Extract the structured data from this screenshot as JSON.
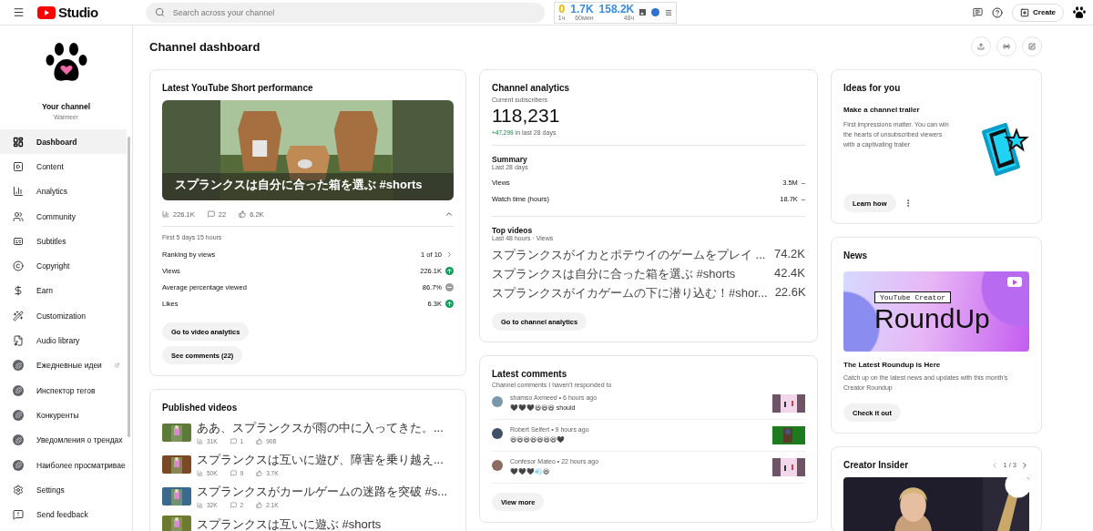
{
  "topbar": {
    "logo_text": "Studio",
    "search": {
      "placeholder": "Search across your channel"
    },
    "stats": [
      {
        "value": "0",
        "caption": "1ч",
        "color": "#e8b400"
      },
      {
        "value": "1.7K",
        "caption": "60мин",
        "color": "#3b8de0"
      },
      {
        "value": "158.2K",
        "caption": "48ч",
        "color": "#3b8de0"
      }
    ],
    "create_label": "Create"
  },
  "sidebar": {
    "channel_title": "Your channel",
    "channel_name": "Warmeer",
    "items": [
      {
        "label": "Dashboard",
        "kind": "nav",
        "selected": true,
        "external": false
      },
      {
        "label": "Content",
        "kind": "nav",
        "selected": false,
        "external": false
      },
      {
        "label": "Analytics",
        "kind": "nav",
        "selected": false,
        "external": false
      },
      {
        "label": "Community",
        "kind": "nav",
        "selected": false,
        "external": false
      },
      {
        "label": "Subtitles",
        "kind": "nav",
        "selected": false,
        "external": false
      },
      {
        "label": "Copyright",
        "kind": "nav",
        "selected": false,
        "external": false
      },
      {
        "label": "Earn",
        "kind": "nav",
        "selected": false,
        "external": false
      },
      {
        "label": "Customization",
        "kind": "nav",
        "selected": false,
        "external": false
      },
      {
        "label": "Audio library",
        "kind": "nav",
        "selected": false,
        "external": false
      },
      {
        "label": "Ежедневные идеи",
        "kind": "extension",
        "selected": false,
        "external": true
      },
      {
        "label": "Инспектор тегов",
        "kind": "extension",
        "selected": false,
        "external": false
      },
      {
        "label": "Конкуренты",
        "kind": "extension",
        "selected": false,
        "external": false
      },
      {
        "label": "Уведомления о трендах",
        "kind": "extension",
        "selected": false,
        "external": false
      },
      {
        "label": "Наиболее просматривае",
        "kind": "extension",
        "selected": false,
        "external": false
      }
    ],
    "footer_items": [
      "Settings",
      "Send feedback"
    ]
  },
  "page_title": "Channel dashboard",
  "short_card": {
    "title": "Latest YouTube Short performance",
    "video_title": "スプランクスは自分に合った箱を選ぶ #shorts",
    "views": "226.1K",
    "comments": "22",
    "likes": "6.2K",
    "expanded": true,
    "period": "First 5 days 15 hours",
    "metrics": [
      {
        "label": "Ranking by views",
        "value": "1 of 10",
        "kind": "link"
      },
      {
        "label": "Views",
        "value": "226.1K",
        "kind": "up"
      },
      {
        "label": "Average percentage viewed",
        "value": "86.7%",
        "kind": "neutral"
      },
      {
        "label": "Likes",
        "value": "6.3K",
        "kind": "up"
      }
    ],
    "buttons": [
      "Go to video analytics",
      "See comments (22)"
    ]
  },
  "published": {
    "title": "Published videos",
    "videos": [
      {
        "title": "ああ、スプランクスが雨の中に入ってきた。...",
        "views": "31K",
        "comments": "1",
        "likes": "908"
      },
      {
        "title": "スプランクスは互いに遊び、障害を乗り越え...",
        "views": "50K",
        "comments": "9",
        "likes": "3.7K"
      },
      {
        "title": "スプランクスがカールゲームの迷路を突破 #s...",
        "views": "32K",
        "comments": "2",
        "likes": "2.1K"
      },
      {
        "title": "スプランクスは互いに遊ぶ #shorts"
      }
    ]
  },
  "analytics": {
    "title": "Channel analytics",
    "subscribers_label": "Current subscribers",
    "subscribers": "118,231",
    "change": "+47,299",
    "change_suffix": "in last 28 days",
    "summary": {
      "title": "Summary",
      "period": "Last 28 days",
      "rows": [
        {
          "label": "Views",
          "value": "3.5M",
          "trend": "–"
        },
        {
          "label": "Watch time (hours)",
          "value": "18.7K",
          "trend": "–"
        }
      ]
    },
    "top": {
      "title": "Top videos",
      "period": "Last 48 hours · Views",
      "rows": [
        {
          "title": "スプランクスがイカとポテウイのゲームをプレイ ...",
          "value": "74.2K"
        },
        {
          "title": "スプランクスは自分に合った箱を選ぶ #shorts",
          "value": "42.4K"
        },
        {
          "title": "スプランクスがイカゲームの下に潜り込む！#shor...",
          "value": "22.6K"
        }
      ]
    },
    "button": "Go to channel analytics"
  },
  "comments": {
    "title": "Latest comments",
    "subtitle": "Channel comments I haven't responded to",
    "items": [
      {
        "author": "shamso Axmeed",
        "separator": "•",
        "time": "6 hours ago",
        "text": "🖤🖤🖤😆😆😆 should",
        "color": "#7a97ab"
      },
      {
        "author": "Robert Seifert",
        "separator": "•",
        "time": "9 hours ago",
        "text": "😆😆😆😆😆😆😆🖤",
        "color": "#3f5068"
      },
      {
        "author": "Confesor Mateo",
        "separator": "•",
        "time": "22 hours ago",
        "text": "🖤🖤🖤💨😆",
        "color": "#8c6b60"
      }
    ],
    "button": "View more"
  },
  "ideas": {
    "title": "Ideas for you",
    "item_title": "Make a channel trailer",
    "description": "First impressions matter. You can win the hearts of unsubscribed viewers with a captivating trailer",
    "button": "Learn how"
  },
  "news": {
    "title": "News",
    "banner_label": "YouTube Creator",
    "banner_title": "RoundUp",
    "headline": "The Latest Roundup is Here",
    "description": "Catch up on the latest news and updates with this month's Creator Roundup",
    "button": "Check it out"
  },
  "insider": {
    "title": "Creator Insider",
    "pager": "1 / 3"
  }
}
